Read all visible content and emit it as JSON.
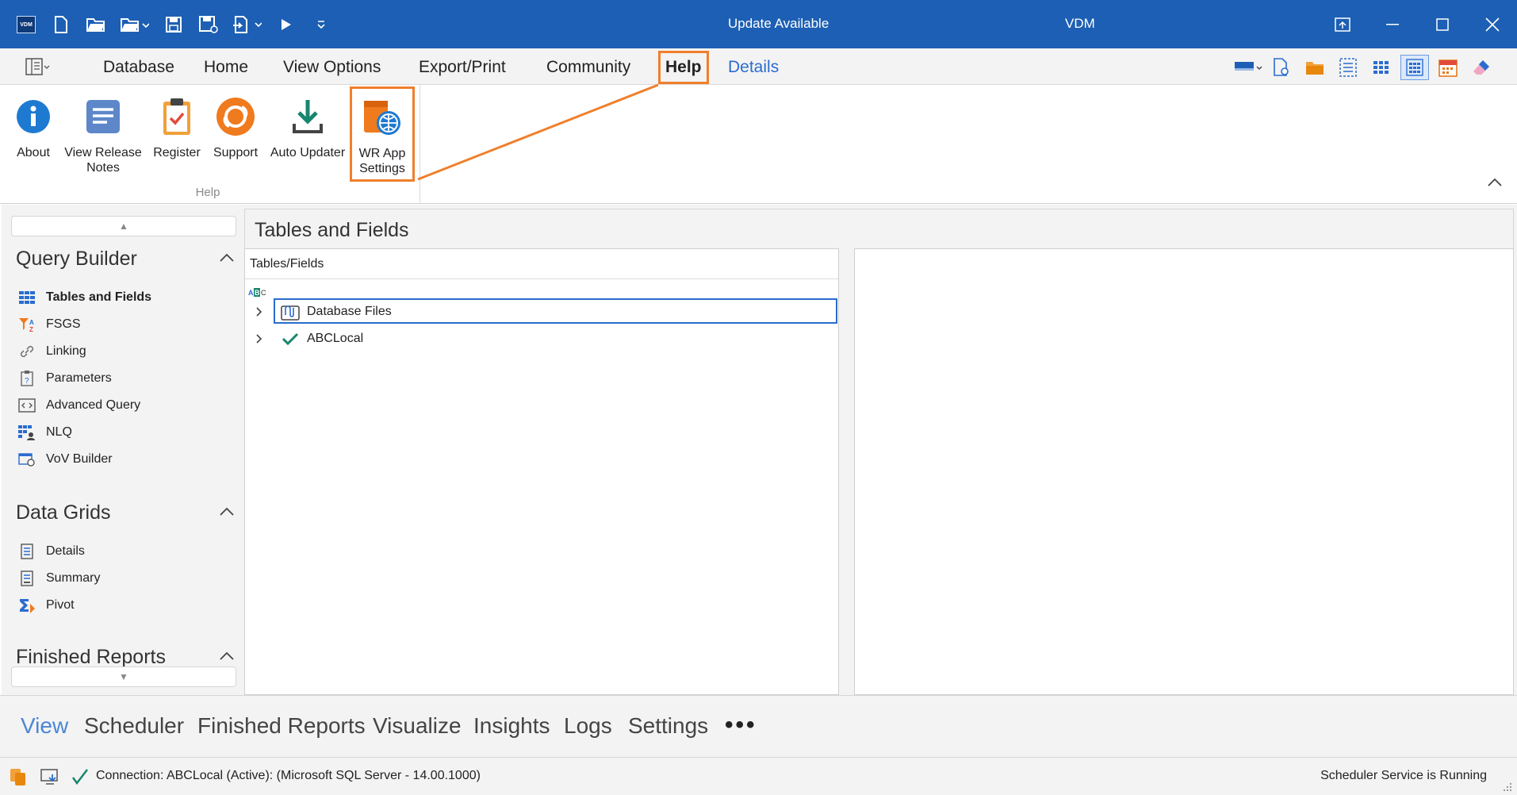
{
  "titlebar": {
    "center_text": "Update Available",
    "app_title": "VDM",
    "logo_text": "VDM",
    "quick_icons": [
      "new-file-icon",
      "open-folder-icon",
      "open-dropdown-icon",
      "save-icon",
      "save-as-icon",
      "export-dropdown-icon",
      "run-icon",
      "customize-icon"
    ],
    "window_controls": [
      "restore-layout-icon",
      "minimize-icon",
      "maximize-icon",
      "close-icon"
    ]
  },
  "menu": {
    "items": [
      "Database",
      "Home",
      "View Options",
      "Export/Print",
      "Community",
      "Help",
      "Details"
    ],
    "active": "Help",
    "highlight_color": "#f07f2b",
    "accent_color": "#2a6ccf"
  },
  "ribbon": {
    "group_label": "Help",
    "buttons": [
      {
        "label1": "About",
        "label2": ""
      },
      {
        "label1": "View Release",
        "label2": "Notes"
      },
      {
        "label1": "Register",
        "label2": ""
      },
      {
        "label1": "Support",
        "label2": ""
      },
      {
        "label1": "Auto Updater",
        "label2": ""
      },
      {
        "label1": "WR App",
        "label2": "Settings"
      }
    ]
  },
  "leftnav": {
    "sections": [
      {
        "title": "Query Builder",
        "items": [
          "Tables and Fields",
          "FSGS",
          "Linking",
          "Parameters",
          "Advanced Query",
          "NLQ",
          "VoV Builder"
        ]
      },
      {
        "title": "Data Grids",
        "items": [
          "Details",
          "Summary",
          "Pivot"
        ]
      },
      {
        "title": "Finished Reports",
        "items": []
      }
    ],
    "selected_item": "Tables and Fields"
  },
  "main": {
    "title": "Tables and Fields",
    "tree_header": "Tables/Fields",
    "tree_rows": [
      {
        "label": "Database Files",
        "selected": true
      },
      {
        "label": "ABCLocal",
        "selected": false
      }
    ]
  },
  "bottomnav": {
    "items": [
      "View",
      "Scheduler",
      "Finished Reports",
      "Visualize",
      "Insights",
      "Logs",
      "Settings"
    ],
    "active": "View",
    "more": "•••"
  },
  "status": {
    "connection": "Connection: ABCLocal (Active): (Microsoft SQL Server - 14.00.1000)",
    "right": "Scheduler Service is Running"
  }
}
